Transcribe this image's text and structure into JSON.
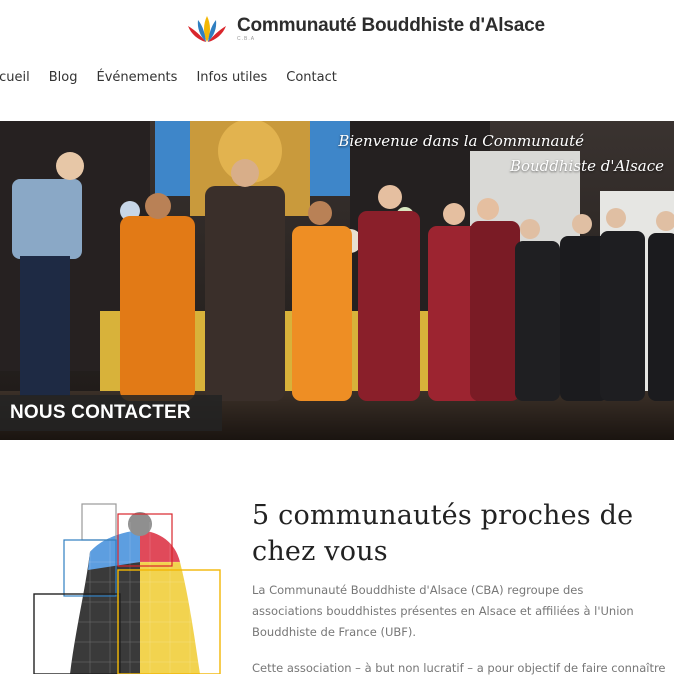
{
  "header": {
    "site_title": "Communauté Bouddhiste d'Alsace",
    "site_subtitle": "C.B.A"
  },
  "nav": {
    "items": [
      "ccueil",
      "Blog",
      "Événements",
      "Infos utiles",
      "Contact"
    ]
  },
  "hero": {
    "caption_line1": "Bienvenue dans la Communauté",
    "caption_line2": "Bouddhiste d'Alsace",
    "contact_button": "NOUS CONTACTER"
  },
  "section": {
    "title_line1": "5 communautés proches de",
    "title_line2": "chez vous",
    "paragraph1": "La Communauté Bouddhiste d'Alsace (CBA) regroupe des associations bouddhistes présentes en Alsace et affiliées à l'Union Bouddhiste de France (UBF).",
    "paragraph2": "Cette association – à but non lucratif – a pour objectif de faire connaître"
  },
  "colors": {
    "logo_red": "#d9262c",
    "logo_yellow": "#f2b705",
    "logo_blue": "#2f7fc1",
    "robe_orange": "#e27a16",
    "robe_maroon": "#8a1f2a"
  }
}
